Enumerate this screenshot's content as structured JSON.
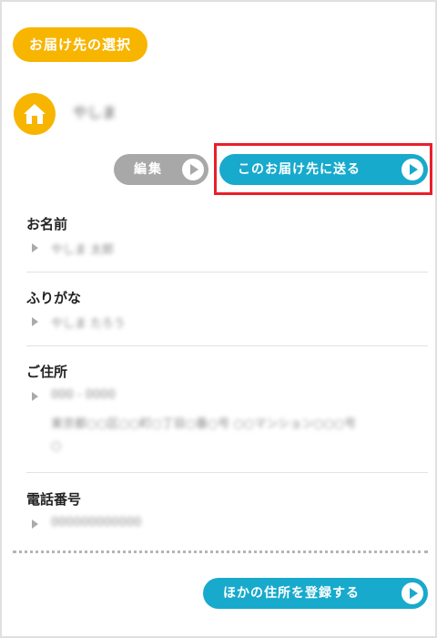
{
  "header": {
    "title": "お届け先の選択"
  },
  "address_card": {
    "name": "やしま",
    "edit_label": "編集",
    "send_label": "このお届け先に送る"
  },
  "fields": [
    {
      "label": "お名前",
      "values": [
        "やしま 太郎"
      ]
    },
    {
      "label": "ふりがな",
      "values": [
        "やしま たろう"
      ]
    },
    {
      "label": "ご住所",
      "values": [
        "000 - 0000",
        "東京都○○区○○町○丁目○番○号 ○○マンション○○○号",
        "○"
      ]
    },
    {
      "label": "電話番号",
      "values": [
        "000000000000"
      ]
    }
  ],
  "footer": {
    "other_address_label": "ほかの住所を登録する"
  },
  "colors": {
    "accent_yellow": "#f7b500",
    "accent_blue": "#18aacc",
    "highlight_red": "#e8202a",
    "button_gray": "#a8a8a8"
  }
}
